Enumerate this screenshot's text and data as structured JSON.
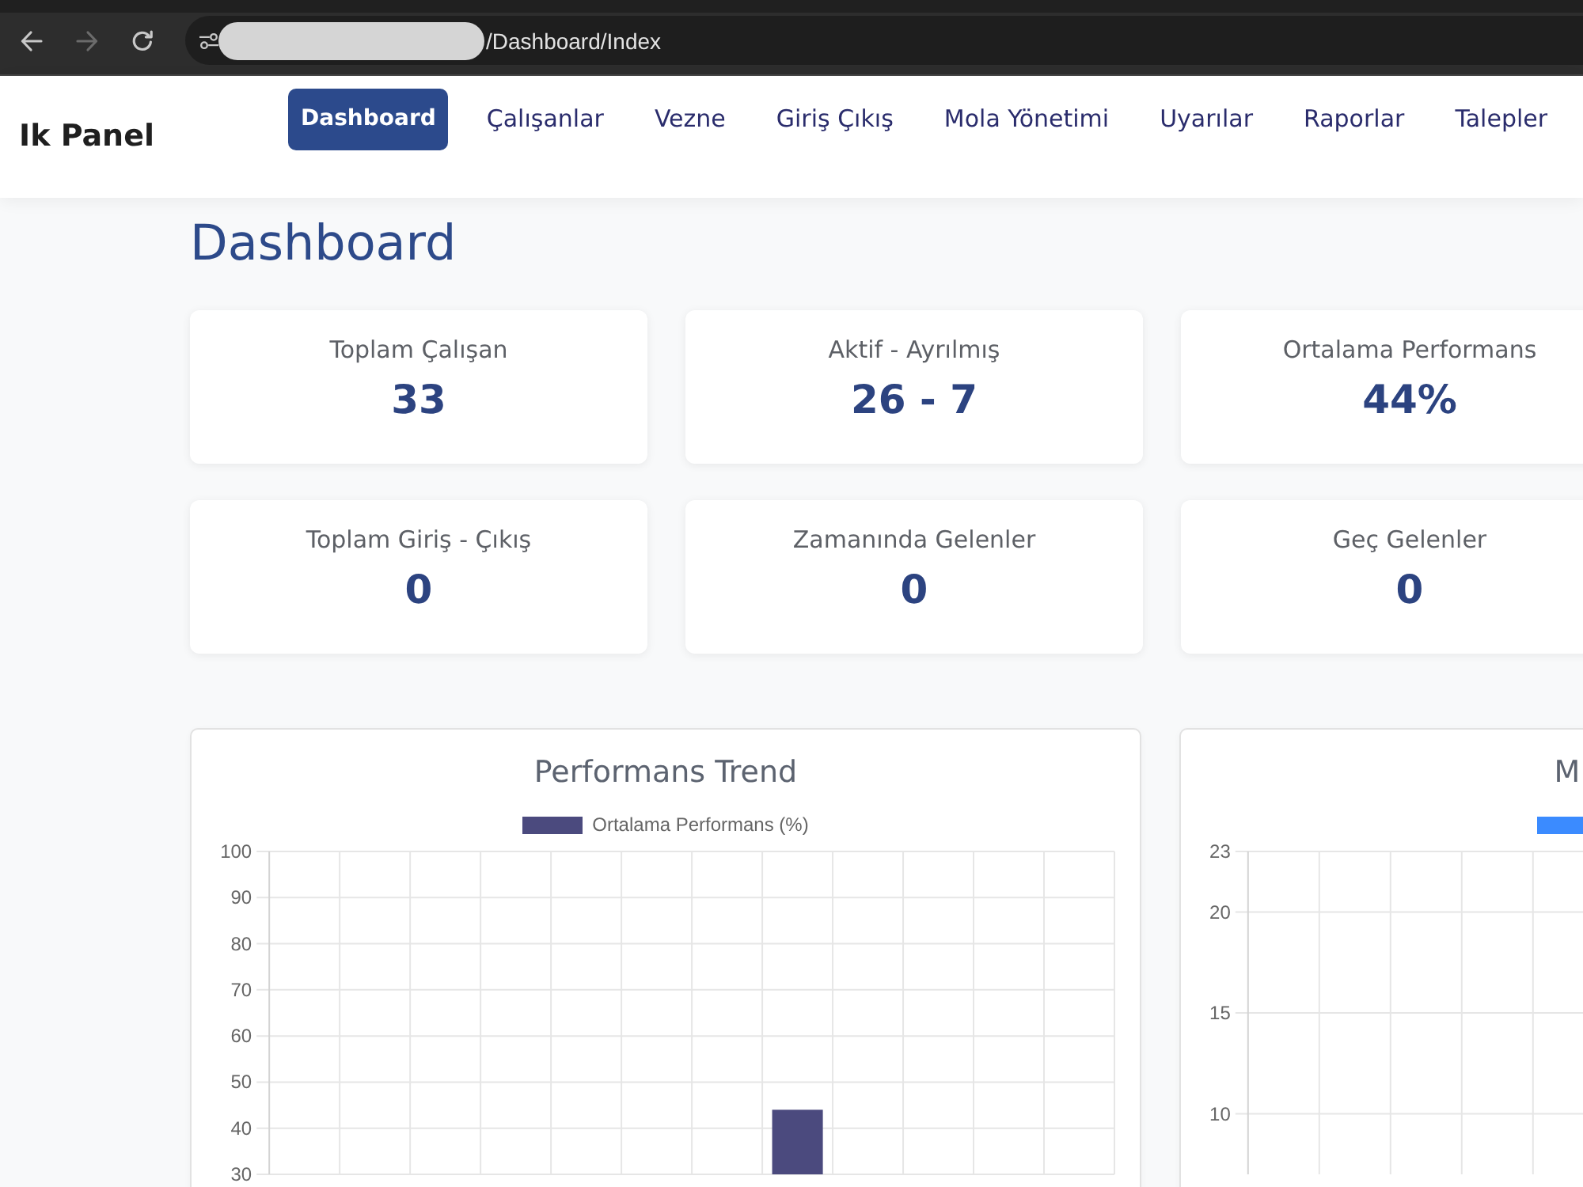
{
  "browser": {
    "nav_buttons": [
      {
        "kind": "back",
        "disabled": false
      },
      {
        "kind": "forward",
        "disabled": true
      },
      {
        "kind": "reload",
        "disabled": false
      }
    ],
    "url": "/Dashboard/Index"
  },
  "navbar": {
    "brand": "Ik Panel",
    "items": [
      {
        "label": "Dashboard",
        "selected": true
      },
      {
        "label": "Çalışanlar",
        "selected": false
      },
      {
        "label": "Vezne",
        "selected": false
      },
      {
        "label": "Giriş Çıkış",
        "selected": false
      },
      {
        "label": "Mola Yönetimi",
        "selected": false
      },
      {
        "label": "Uyarılar",
        "selected": false
      },
      {
        "label": "Raporlar",
        "selected": false
      },
      {
        "label": "Talepler",
        "selected": false
      }
    ]
  },
  "page": {
    "title": "Dashboard"
  },
  "stats": [
    {
      "label": "Toplam Çalışan",
      "value": "33"
    },
    {
      "label": "Aktif - Ayrılmış",
      "value": "26 - 7"
    },
    {
      "label": "Ortalama Performans",
      "value": "44%"
    },
    {
      "label": "Toplam Giriş - Çıkış",
      "value": "0"
    },
    {
      "label": "Zamanında Gelenler",
      "value": "0"
    },
    {
      "label": "Geç Gelenler",
      "value": "0"
    }
  ],
  "charts": [
    {
      "chart_data": {
        "type": "bar",
        "title": "Performans Trend",
        "series": [
          {
            "name": "Ortalama Performans (%)",
            "color": "#4b4a7e",
            "values": [
              null,
              null,
              null,
              null,
              null,
              null,
              null,
              44,
              null,
              null,
              null,
              null
            ]
          }
        ],
        "ylim": [
          30,
          100
        ],
        "yticks": [
          30,
          40,
          50,
          60,
          70,
          80,
          90,
          100
        ],
        "grid": true
      }
    },
    {
      "chart_data": {
        "type": "bar",
        "title": "M",
        "series": [
          {
            "color": "#3b8bff"
          }
        ],
        "ylim": [
          7,
          23
        ],
        "yticks": [
          10,
          15,
          20,
          23
        ],
        "grid": true
      }
    }
  ]
}
